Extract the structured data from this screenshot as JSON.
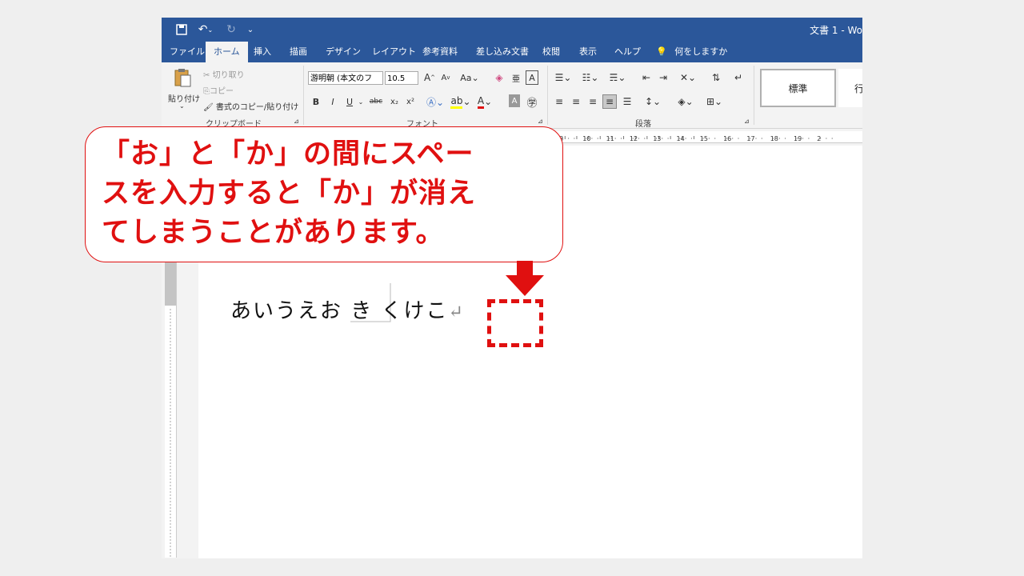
{
  "titlebar": {
    "doc_title": "文書 1  -  Wo",
    "qat_save_icon": "save-icon",
    "qat_undo_icon": "undo-icon",
    "qat_redo_icon": "redo-icon",
    "qat_customize_icon": "dropdown-icon"
  },
  "tabs": [
    "ファイル",
    "ホーム",
    "挿入",
    "描画",
    "デザイン",
    "レイアウト",
    "参考資料",
    "差し込み文書",
    "校閲",
    "表示",
    "ヘルプ"
  ],
  "tell_me": "何をしますか",
  "clipboard": {
    "paste_label": "貼り付け",
    "cut_label": "切り取り",
    "copy_label": "コピー",
    "format_painter_label": "書式のコピー/貼り付け",
    "group_label": "クリップボード"
  },
  "font": {
    "font_name": "游明朝 (本文のフ",
    "font_size": "10.5",
    "group_label": "フォント",
    "buttons": [
      "B",
      "I",
      "U",
      "abc",
      "x₂",
      "x²"
    ]
  },
  "paragraph": {
    "group_label": "段落"
  },
  "styles": {
    "items": [
      "標準",
      "行"
    ]
  },
  "ruler": {
    "numbers": [
      "8",
      "10",
      "11",
      "12",
      "13",
      "14",
      "15",
      "16",
      "17",
      "18",
      "19",
      "2"
    ]
  },
  "document": {
    "body_text": "あいうえお き くけこ",
    "paragraph_mark": "↵"
  },
  "callout": {
    "lines": [
      "「お」と「か」の間にスペー",
      "スを入力すると「か」が消え",
      "てしまうことがあります。"
    ]
  },
  "colors": {
    "accent": "#2b579a",
    "annotation": "#e01010"
  }
}
